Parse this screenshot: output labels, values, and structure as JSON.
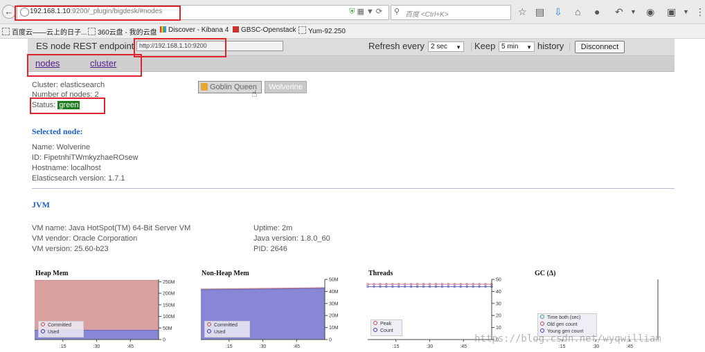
{
  "browser": {
    "url_host": "192.168.1.10",
    "url_rest": ":9200/_plugin/bigdesk/#nodes",
    "search_placeholder": "百度 <Ctrl+K>",
    "bookmarks": [
      "百度云——云上的日子...",
      "360云盘 - 我的云盘",
      "Discover - Kibana 4",
      "GBSC-Openstack",
      "Yum-92.250"
    ]
  },
  "header": {
    "endpoint_label": "ES node REST endpoint",
    "endpoint_value": "http://192.168.1.10:9200",
    "refresh_label": "Refresh every",
    "refresh_value": "2 sec",
    "keep_label": "Keep",
    "keep_value": "5 min",
    "history_label": "history",
    "disconnect_label": "Disconnect"
  },
  "tabs": {
    "nodes": "nodes",
    "cluster": "cluster"
  },
  "cluster": {
    "name_line": "Cluster: elasticsearch",
    "count_line": "Number of nodes: 2",
    "status_label": "Status:",
    "status_value": "green",
    "status_color": "#1e7c1e"
  },
  "nodes": [
    "Goblin Queen",
    "Wolverine"
  ],
  "selected_node": {
    "title": "Selected node:",
    "name": "Name: Wolverine",
    "id": "ID: FipetnhiTWmkyzhaeROsew",
    "hostname": "Hostname: localhost",
    "es_version": "Elasticsearch version: 1.7.1"
  },
  "jvm": {
    "title": "JVM",
    "vm_name": "VM name: Java HotSpot(TM) 64-Bit Server VM",
    "vm_vendor": "VM vendor: Oracle Corporation",
    "vm_version": "VM version: 25.60-b23",
    "uptime": "Uptime: 2m",
    "java_version": "Java version: 1.8.0_60",
    "pid": "PID: 2646"
  },
  "watermark": "https://blog.csdn.net/wyqwilliam",
  "chart_data": [
    {
      "type": "area",
      "title": "Heap Mem",
      "x_ticks": [
        ":15",
        ":30",
        ":45"
      ],
      "y_ticks": [
        "0",
        "50M",
        "100M",
        "150M",
        "200M",
        "250M"
      ],
      "ylim": [
        0,
        260
      ],
      "series": [
        {
          "name": "Committed",
          "color": "#d9a0a0",
          "values": [
            256,
            256,
            256,
            256,
            256
          ]
        },
        {
          "name": "Used",
          "color": "#8787d6",
          "values": [
            40,
            40,
            40,
            40,
            40
          ]
        }
      ]
    },
    {
      "type": "area",
      "title": "Non-Heap Mem",
      "x_ticks": [
        ":15",
        ":30",
        ":45"
      ],
      "y_ticks": [
        "0",
        "10M",
        "20M",
        "30M",
        "40M",
        "50M"
      ],
      "ylim": [
        0,
        50
      ],
      "series": [
        {
          "name": "Committed",
          "color": "#d9a0a0",
          "values": [
            42,
            42.3,
            42.6,
            42.9,
            43.2
          ]
        },
        {
          "name": "Used",
          "color": "#8787d6",
          "values": [
            41.3,
            41.6,
            41.9,
            42.2,
            42.5
          ]
        }
      ]
    },
    {
      "type": "line",
      "title": "Threads",
      "x_ticks": [
        ":15",
        ":30",
        ":45"
      ],
      "y_ticks": [
        "0",
        "10",
        "20",
        "30",
        "40",
        "50"
      ],
      "ylim": [
        0,
        50
      ],
      "series": [
        {
          "name": "Peak",
          "color": "#c07a9a",
          "values": [
            46,
            46,
            46,
            46,
            46,
            46,
            46,
            46,
            46,
            46,
            46,
            46,
            46,
            46,
            46,
            46,
            46,
            46,
            46,
            46,
            46
          ]
        },
        {
          "name": "Count",
          "color": "#6a6ad0",
          "values": [
            44,
            44,
            44,
            44,
            44,
            44,
            44,
            44,
            44,
            44,
            44,
            44,
            44,
            44,
            44,
            44,
            44,
            44,
            44,
            44,
            44
          ]
        }
      ]
    },
    {
      "type": "line",
      "title": "GC (Δ)",
      "x_ticks": [
        ":15",
        ":30",
        ":45"
      ],
      "y_ticks": [],
      "series": [
        {
          "name": "Time both (sec)",
          "color": "#5bb0a0",
          "values": []
        },
        {
          "name": "Old gen count",
          "color": "#c07a9a",
          "values": []
        },
        {
          "name": "Young gen count",
          "color": "#6a6ad0",
          "values": []
        }
      ]
    }
  ]
}
